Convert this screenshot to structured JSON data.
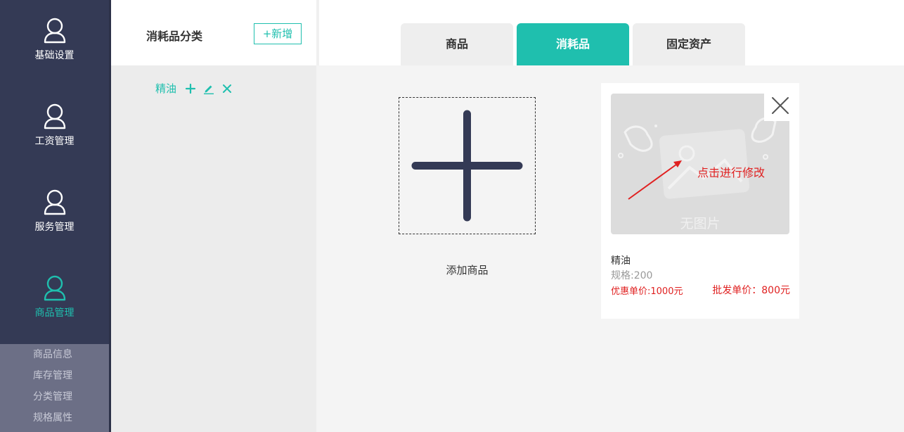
{
  "nav": {
    "items": [
      {
        "label": "基础设置",
        "icon": "user-icon"
      },
      {
        "label": "工资管理",
        "icon": "user-icon"
      },
      {
        "label": "服务管理",
        "icon": "user-icon"
      },
      {
        "label": "商品管理",
        "icon": "user-icon",
        "active": true
      }
    ],
    "sub_items": [
      "商品信息",
      "库存管理",
      "分类管理",
      "规格属性"
    ]
  },
  "category": {
    "title": "消耗品分类",
    "add_label": "+新增",
    "items": [
      {
        "name": "精油"
      }
    ]
  },
  "tabs": [
    {
      "label": "商品"
    },
    {
      "label": "消耗品",
      "active": true
    },
    {
      "label": "固定资产"
    }
  ],
  "main": {
    "add_product_label": "添加商品",
    "products": [
      {
        "name": "精油",
        "spec": "规格:200",
        "discount_price": "优惠单价:1000元",
        "wholesale_price": "批发单价：800元",
        "no_image_text": "无图片",
        "edit_hint": "点击进行修改"
      }
    ]
  },
  "colors": {
    "accent": "#1fbfae",
    "nav_bg": "#343a55",
    "price": "#e02020"
  }
}
